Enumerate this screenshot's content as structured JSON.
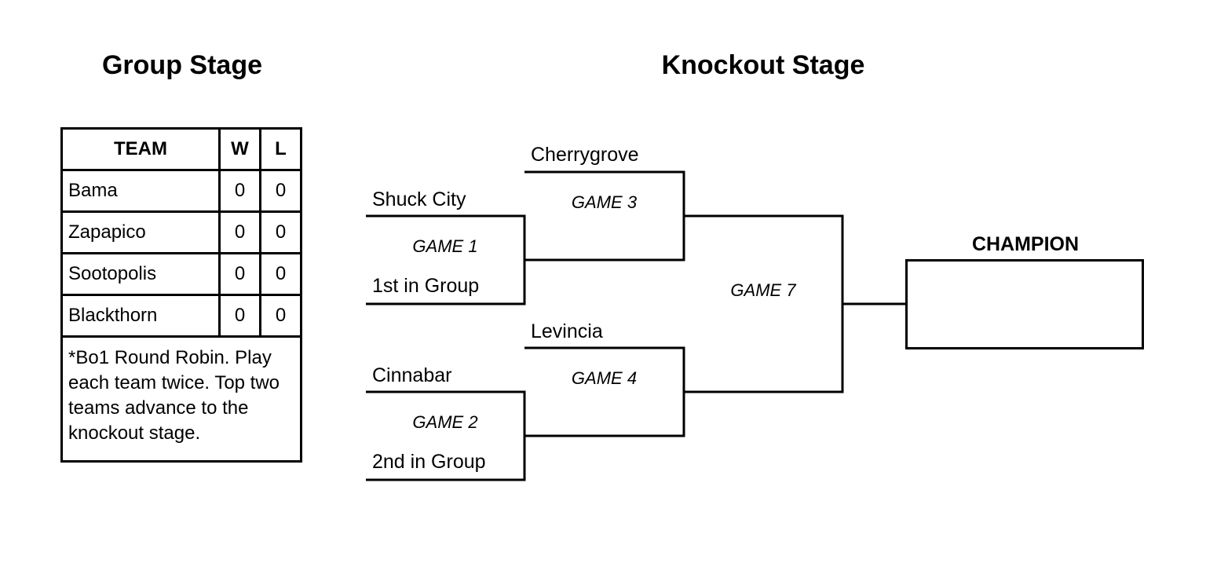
{
  "headings": {
    "group": "Group Stage",
    "knockout": "Knockout Stage"
  },
  "group_table": {
    "headers": {
      "team": "TEAM",
      "w": "W",
      "l": "L"
    },
    "rows": [
      {
        "team": "Bama",
        "w": "0",
        "l": "0"
      },
      {
        "team": "Zapapico",
        "w": "0",
        "l": "0"
      },
      {
        "team": "Sootopolis",
        "w": "0",
        "l": "0"
      },
      {
        "team": "Blackthorn",
        "w": "0",
        "l": "0"
      }
    ],
    "note": "*Bo1 Round Robin. Play each team twice. Top two teams advance to the knockout stage."
  },
  "bracket": {
    "teams": {
      "game1_top": "Shuck City",
      "game1_bottom": "1st in Group",
      "game2_top": "Cinnabar",
      "game2_bottom": "2nd in Group",
      "game3_top": "Cherrygrove",
      "game4_top": "Levincia"
    },
    "games": {
      "game1": "GAME 1",
      "game2": "GAME 2",
      "game3": "GAME 3",
      "game4": "GAME 4",
      "game7": "GAME 7"
    },
    "champion": "CHAMPION"
  }
}
